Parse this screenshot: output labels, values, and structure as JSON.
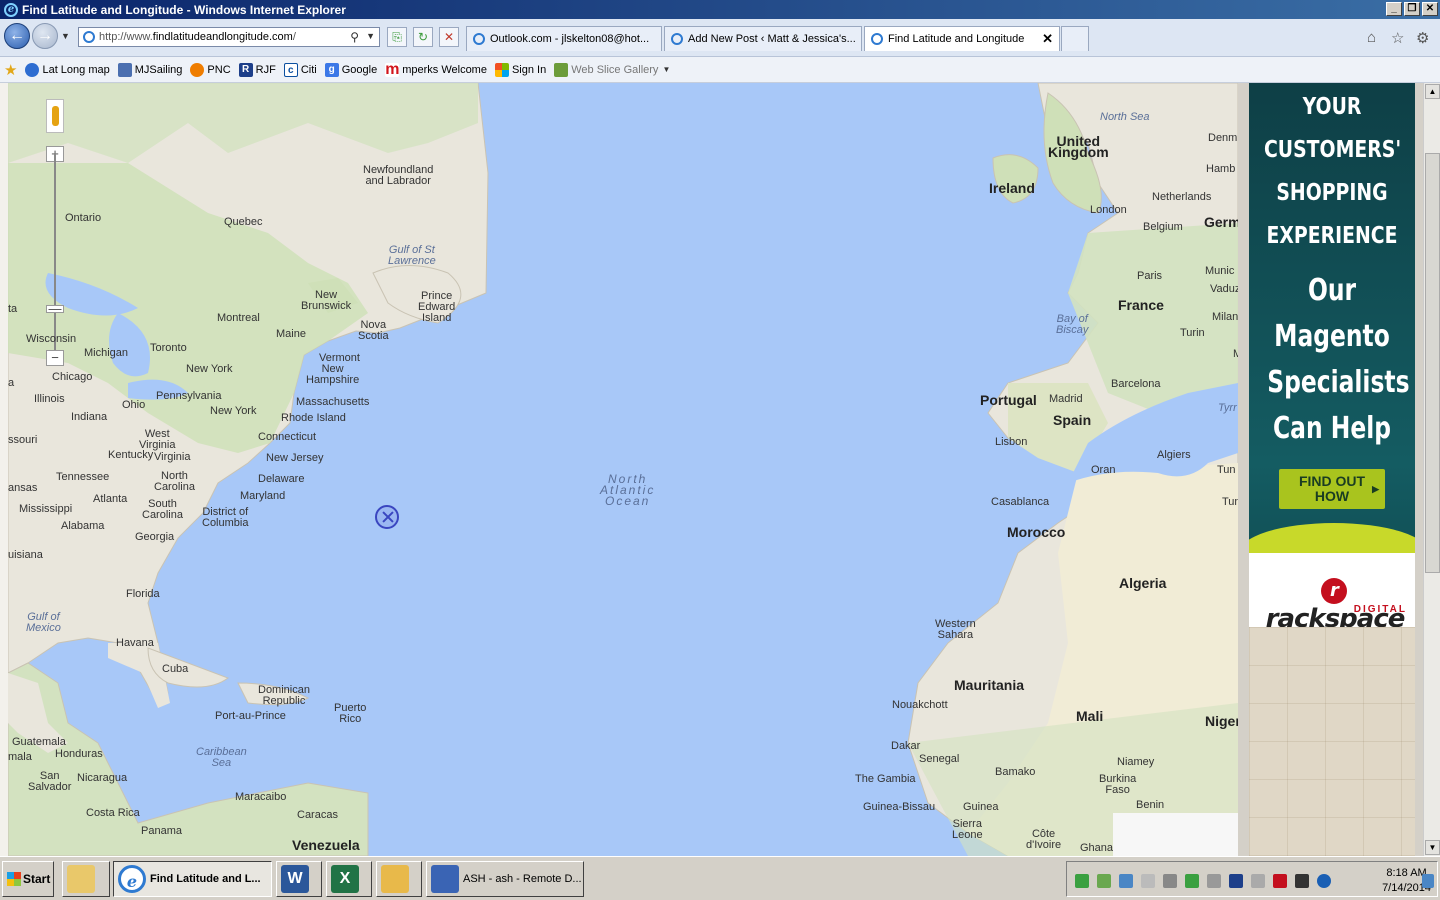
{
  "window": {
    "title": "Find Latitude and Longitude - Windows Internet Explorer"
  },
  "address_bar": {
    "prefix": "http://www.",
    "domain": "findlatitudeandlongitude.com",
    "suffix": "/"
  },
  "tabs": [
    {
      "label": "Outlook.com - jlskelton08@hot...",
      "active": false
    },
    {
      "label": "Add New Post ‹ Matt & Jessica's...",
      "active": false
    },
    {
      "label": "Find Latitude and Longitude",
      "active": true
    }
  ],
  "favorites": [
    {
      "label": "Lat Long map",
      "icon": "globe-icon",
      "color": "#2e6dd1"
    },
    {
      "label": "MJSailing",
      "icon": "page-icon",
      "color": "#4b6fb0"
    },
    {
      "label": "PNC",
      "icon": "pnc-icon",
      "color": "#ef7d00"
    },
    {
      "label": "RJF",
      "icon": "rjf-icon",
      "color": "#1d3f8a"
    },
    {
      "label": "Citi",
      "icon": "citi-icon",
      "color": "#0a4fa0"
    },
    {
      "label": "Google",
      "icon": "google-icon",
      "color": "#3b78e7"
    },
    {
      "label": "mperks Welcome",
      "icon": "mperks-icon",
      "color": "#d2141b"
    },
    {
      "label": "Sign In",
      "icon": "windows-icon",
      "color": "#f25022"
    },
    {
      "label": "Web Slice Gallery",
      "icon": "webslice-icon",
      "color": "#6c9c3a"
    }
  ],
  "map": {
    "labels": [
      {
        "text": "Newfoundland\nand Labrador",
        "kind": "place"
      },
      {
        "text": "Ontario",
        "kind": "place"
      },
      {
        "text": "Quebec",
        "kind": "place"
      },
      {
        "text": "Gulf of St\nLawrence",
        "kind": "water"
      },
      {
        "text": "New\nBrunswick",
        "kind": "place"
      },
      {
        "text": "Prince\nEdward\nIsland",
        "kind": "place"
      },
      {
        "text": "Montreal",
        "kind": "place"
      },
      {
        "text": "Nova\nScotia",
        "kind": "place"
      },
      {
        "text": "Maine",
        "kind": "place"
      },
      {
        "text": "ta",
        "kind": "place"
      },
      {
        "text": "Wisconsin",
        "kind": "place"
      },
      {
        "text": "Toronto",
        "kind": "place"
      },
      {
        "text": "Michigan",
        "kind": "place"
      },
      {
        "text": "Vermont",
        "kind": "place"
      },
      {
        "text": "New\nHampshire",
        "kind": "place"
      },
      {
        "text": "New York",
        "kind": "place"
      },
      {
        "text": "Chicago",
        "kind": "place"
      },
      {
        "text": "a",
        "kind": "place"
      },
      {
        "text": "Pennsylvania",
        "kind": "place"
      },
      {
        "text": "Illinois",
        "kind": "place"
      },
      {
        "text": "Ohio",
        "kind": "place"
      },
      {
        "text": "Massachusetts",
        "kind": "place"
      },
      {
        "text": "New York",
        "kind": "place"
      },
      {
        "text": "Indiana",
        "kind": "place"
      },
      {
        "text": "Rhode Island",
        "kind": "place"
      },
      {
        "text": "ssouri",
        "kind": "place"
      },
      {
        "text": "West\nVirginia",
        "kind": "place"
      },
      {
        "text": "Connecticut",
        "kind": "place"
      },
      {
        "text": "Kentucky",
        "kind": "place"
      },
      {
        "text": "Virginia",
        "kind": "place"
      },
      {
        "text": "New Jersey",
        "kind": "place"
      },
      {
        "text": "Tennessee",
        "kind": "place"
      },
      {
        "text": "North\nCarolina",
        "kind": "place"
      },
      {
        "text": "Delaware",
        "kind": "place"
      },
      {
        "text": "ansas",
        "kind": "place"
      },
      {
        "text": "Atlanta",
        "kind": "place"
      },
      {
        "text": "Maryland",
        "kind": "place"
      },
      {
        "text": "Mississippi",
        "kind": "place"
      },
      {
        "text": "South\nCarolina",
        "kind": "place"
      },
      {
        "text": "District of\nColumbia",
        "kind": "place"
      },
      {
        "text": "Alabama",
        "kind": "place"
      },
      {
        "text": "Georgia",
        "kind": "place"
      },
      {
        "text": "uisiana",
        "kind": "place"
      },
      {
        "text": "Florida",
        "kind": "place"
      },
      {
        "text": "Gulf of\nMexico",
        "kind": "water"
      },
      {
        "text": "Havana",
        "kind": "place"
      },
      {
        "text": "Cuba",
        "kind": "place"
      },
      {
        "text": "Dominican\nRepublic",
        "kind": "place"
      },
      {
        "text": "Puerto\nRico",
        "kind": "place"
      },
      {
        "text": "Port-au-Prince",
        "kind": "place"
      },
      {
        "text": "Guatemala",
        "kind": "place"
      },
      {
        "text": "Honduras",
        "kind": "place"
      },
      {
        "text": "mala",
        "kind": "place"
      },
      {
        "text": "Caribbean\nSea",
        "kind": "water"
      },
      {
        "text": "San\nSalvador",
        "kind": "place"
      },
      {
        "text": "Nicaragua",
        "kind": "place"
      },
      {
        "text": "Maracaibo",
        "kind": "place"
      },
      {
        "text": "Costa Rica",
        "kind": "place"
      },
      {
        "text": "Caracas",
        "kind": "place"
      },
      {
        "text": "Panama",
        "kind": "place"
      },
      {
        "text": "Venezuela",
        "kind": "country"
      },
      {
        "text": "North\nAtlantic\nOcean",
        "kind": "ocean"
      },
      {
        "text": "North Sea",
        "kind": "water"
      },
      {
        "text": "United\nKingdom",
        "kind": "country"
      },
      {
        "text": "Denm",
        "kind": "place"
      },
      {
        "text": "Ireland",
        "kind": "country"
      },
      {
        "text": "Hamb",
        "kind": "place"
      },
      {
        "text": "Netherlands",
        "kind": "place"
      },
      {
        "text": "London",
        "kind": "place"
      },
      {
        "text": "Germ",
        "kind": "country"
      },
      {
        "text": "Belgium",
        "kind": "place"
      },
      {
        "text": "Munic",
        "kind": "place"
      },
      {
        "text": "Paris",
        "kind": "place"
      },
      {
        "text": "Vaduz",
        "kind": "place"
      },
      {
        "text": "France",
        "kind": "country"
      },
      {
        "text": "Milan",
        "kind": "place"
      },
      {
        "text": "Bay of\nBiscay",
        "kind": "water"
      },
      {
        "text": "Turin",
        "kind": "place"
      },
      {
        "text": "Marseille",
        "kind": "place"
      },
      {
        "text": "Barcelona",
        "kind": "place"
      },
      {
        "text": "Portugal",
        "kind": "country"
      },
      {
        "text": "Madrid",
        "kind": "place"
      },
      {
        "text": "Tyrr",
        "kind": "water"
      },
      {
        "text": "Spain",
        "kind": "country"
      },
      {
        "text": "Lisbon",
        "kind": "place"
      },
      {
        "text": "Algiers",
        "kind": "place"
      },
      {
        "text": "Oran",
        "kind": "place"
      },
      {
        "text": "Tun",
        "kind": "place"
      },
      {
        "text": "Casablanca",
        "kind": "place"
      },
      {
        "text": "Tunisi",
        "kind": "place"
      },
      {
        "text": "Morocco",
        "kind": "country"
      },
      {
        "text": "Algeria",
        "kind": "country"
      },
      {
        "text": "Western\nSahara",
        "kind": "place"
      },
      {
        "text": "Mauritania",
        "kind": "country"
      },
      {
        "text": "Nouakchott",
        "kind": "place"
      },
      {
        "text": "Mali",
        "kind": "country"
      },
      {
        "text": "Niger",
        "kind": "country"
      },
      {
        "text": "Dakar",
        "kind": "place"
      },
      {
        "text": "Senegal",
        "kind": "place"
      },
      {
        "text": "Niamey",
        "kind": "place"
      },
      {
        "text": "The Gambia",
        "kind": "place"
      },
      {
        "text": "Bamako",
        "kind": "place"
      },
      {
        "text": "Burkina\nFaso",
        "kind": "place"
      },
      {
        "text": "Guinea-Bissau",
        "kind": "place"
      },
      {
        "text": "Guinea",
        "kind": "place"
      },
      {
        "text": "Benin",
        "kind": "place"
      },
      {
        "text": "Sierra\nLeone",
        "kind": "place"
      },
      {
        "text": "Côte\nd'Ivoire",
        "kind": "place"
      },
      {
        "text": "Ghana",
        "kind": "place"
      }
    ],
    "controls": {
      "zoom_in": "+",
      "zoom_out": "−"
    }
  },
  "ad": {
    "headline": [
      "YOUR",
      "CUSTOMERS'",
      "SHOPPING",
      "EXPERIENCE"
    ],
    "subline": [
      "Our",
      "Magento",
      "Specialists",
      "Can Help"
    ],
    "cta": "FIND OUT\nHOW",
    "brand": "rackspace",
    "brand_sub": "DIGITAL",
    "colors": {
      "background": "#0e474e",
      "accent": "#a9c41e",
      "brand": "#c40f1e"
    }
  },
  "taskbar": {
    "start": "Start",
    "buttons": [
      {
        "label": "",
        "icon": "explorer-icon"
      },
      {
        "label": "Find Latitude and L...",
        "icon": "ie-icon",
        "active": true
      },
      {
        "label": "",
        "icon": "word-icon"
      },
      {
        "label": "",
        "icon": "excel-icon"
      },
      {
        "label": "",
        "icon": "outlook-icon"
      },
      {
        "label": "ASH - ash - Remote D...",
        "icon": "remote-desktop-icon"
      }
    ],
    "clock": {
      "time": "8:18 AM",
      "date": "7/14/2014"
    }
  }
}
